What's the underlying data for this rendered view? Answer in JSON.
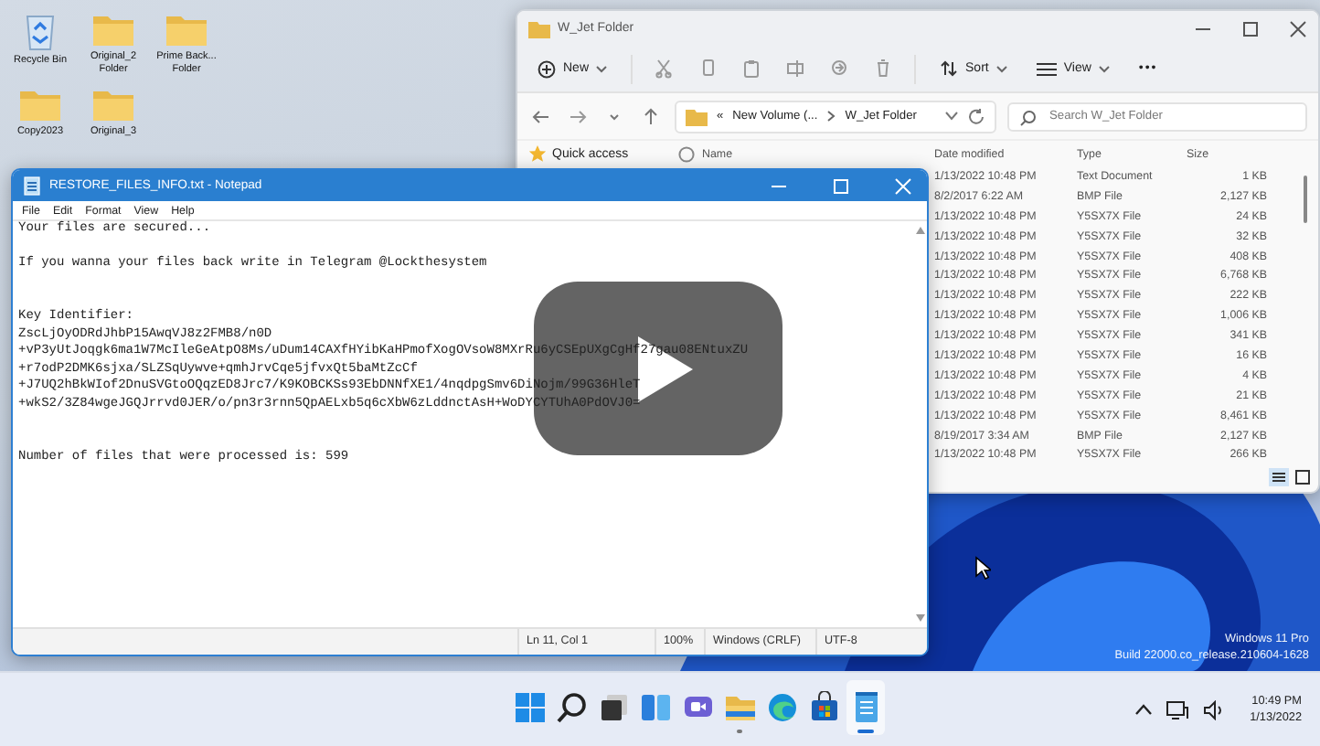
{
  "desktop": {
    "icons": [
      {
        "kind": "recycle-bin",
        "label": "Recycle Bin"
      },
      {
        "kind": "folder",
        "label": "Original_2 Folder"
      },
      {
        "kind": "folder",
        "label": "Prime Back... Folder"
      },
      {
        "kind": "folder",
        "label": "Copy2023"
      },
      {
        "kind": "folder",
        "label": "Original_3"
      }
    ],
    "watermark": [
      "Windows 11 Pro",
      "Build 22000.co_release.210604-1628"
    ]
  },
  "explorer": {
    "title": "W_Jet Folder",
    "toolbar": {
      "new": "New",
      "sort": "Sort",
      "view": "View",
      "more": "•••"
    },
    "address": {
      "overflow": "«",
      "crumbs": [
        "New Volume (...",
        "W_Jet Folder"
      ]
    },
    "search": {
      "placeholder": "Search W_Jet Folder"
    },
    "nav": [
      {
        "label": "Quick access"
      }
    ],
    "columns": [
      "Name",
      "Date modified",
      "Type",
      "Size"
    ],
    "rows": [
      {
        "date": "1/13/2022 10:48 PM",
        "type": "Text Document",
        "size": "1 KB"
      },
      {
        "date": "8/2/2017 6:22 AM",
        "type": "BMP File",
        "size": "2,127 KB"
      },
      {
        "date": "1/13/2022 10:48 PM",
        "type": "Y5SX7X File",
        "size": "24 KB"
      },
      {
        "date": "1/13/2022 10:48 PM",
        "type": "Y5SX7X File",
        "size": "32 KB"
      },
      {
        "date": "1/13/2022 10:48 PM",
        "type": "Y5SX7X File",
        "size": "408 KB"
      },
      {
        "date": "1/13/2022 10:48 PM",
        "type": "Y5SX7X File",
        "size": "6,768 KB"
      },
      {
        "date": "1/13/2022 10:48 PM",
        "type": "Y5SX7X File",
        "size": "222 KB"
      },
      {
        "date": "1/13/2022 10:48 PM",
        "type": "Y5SX7X File",
        "size": "1,006 KB"
      },
      {
        "date": "1/13/2022 10:48 PM",
        "type": "Y5SX7X File",
        "size": "341 KB"
      },
      {
        "date": "1/13/2022 10:48 PM",
        "type": "Y5SX7X File",
        "size": "16 KB"
      },
      {
        "date": "1/13/2022 10:48 PM",
        "type": "Y5SX7X File",
        "size": "4 KB"
      },
      {
        "date": "1/13/2022 10:48 PM",
        "type": "Y5SX7X File",
        "size": "21 KB"
      },
      {
        "date": "1/13/2022 10:48 PM",
        "type": "Y5SX7X File",
        "size": "8,461 KB"
      },
      {
        "date": "8/19/2017 3:34 AM",
        "type": "BMP File",
        "size": "2,127 KB"
      },
      {
        "date": "1/13/2022 10:48 PM",
        "type": "Y5SX7X File",
        "size": "266 KB"
      }
    ]
  },
  "notepad": {
    "title": "RESTORE_FILES_INFO.txt - Notepad",
    "menu": [
      "File",
      "Edit",
      "Format",
      "View",
      "Help"
    ],
    "text": "Your files are secured...\n\nIf you wanna your files back write in Telegram @Lockthesystem\n\n\nKey Identifier:\nZscLjOyODRdJhbP15AwqVJ8z2FMB8/n0D\n+vP3yUtJoqgk6ma1W7McIleGeAtpO8Ms/uDum14CAXfHYibKaHPmofXogOVsoW8MXrRu6yCSEpUXgCgHf27gau08ENtuxZU\n+r7odP2DMK6sjxa/SLZSqUywve+qmhJrvCqe5jfvxQt5baMtZcCf\n+J7UQ2hBkWIof2DnuSVGtoOQqzED8Jrc7/K9KOBCKSs93EbDNNfXE1/4nqdpgSmv6DiNojm/99G36HleT\n+wkS2/3Z84wgeJGQJrrvd0JER/o/pn3r3rnn5QpAELxb5q6cXbW6zLddnctAsH+WoDYCYTUhA0PdOVJ0=\n\n\nNumber of files that were processed is: 599",
    "status": [
      "Ln 11, Col 1",
      "100%",
      "Windows (CRLF)",
      "UTF-8"
    ]
  },
  "video": {
    "play_button": true
  },
  "taskbar": {
    "apps": [
      {
        "kind": "start",
        "running": false,
        "selected": false
      },
      {
        "kind": "search",
        "running": false,
        "selected": false
      },
      {
        "kind": "task-view",
        "running": false,
        "selected": false
      },
      {
        "kind": "widgets",
        "running": false,
        "selected": false
      },
      {
        "kind": "chat",
        "running": false,
        "selected": false
      },
      {
        "kind": "explorer",
        "running": true,
        "selected": false
      },
      {
        "kind": "edge",
        "running": false,
        "selected": false
      },
      {
        "kind": "store",
        "running": false,
        "selected": false
      },
      {
        "kind": "notepad",
        "running": true,
        "selected": true
      }
    ],
    "time": "10:49 PM",
    "date": "1/13/2022"
  }
}
